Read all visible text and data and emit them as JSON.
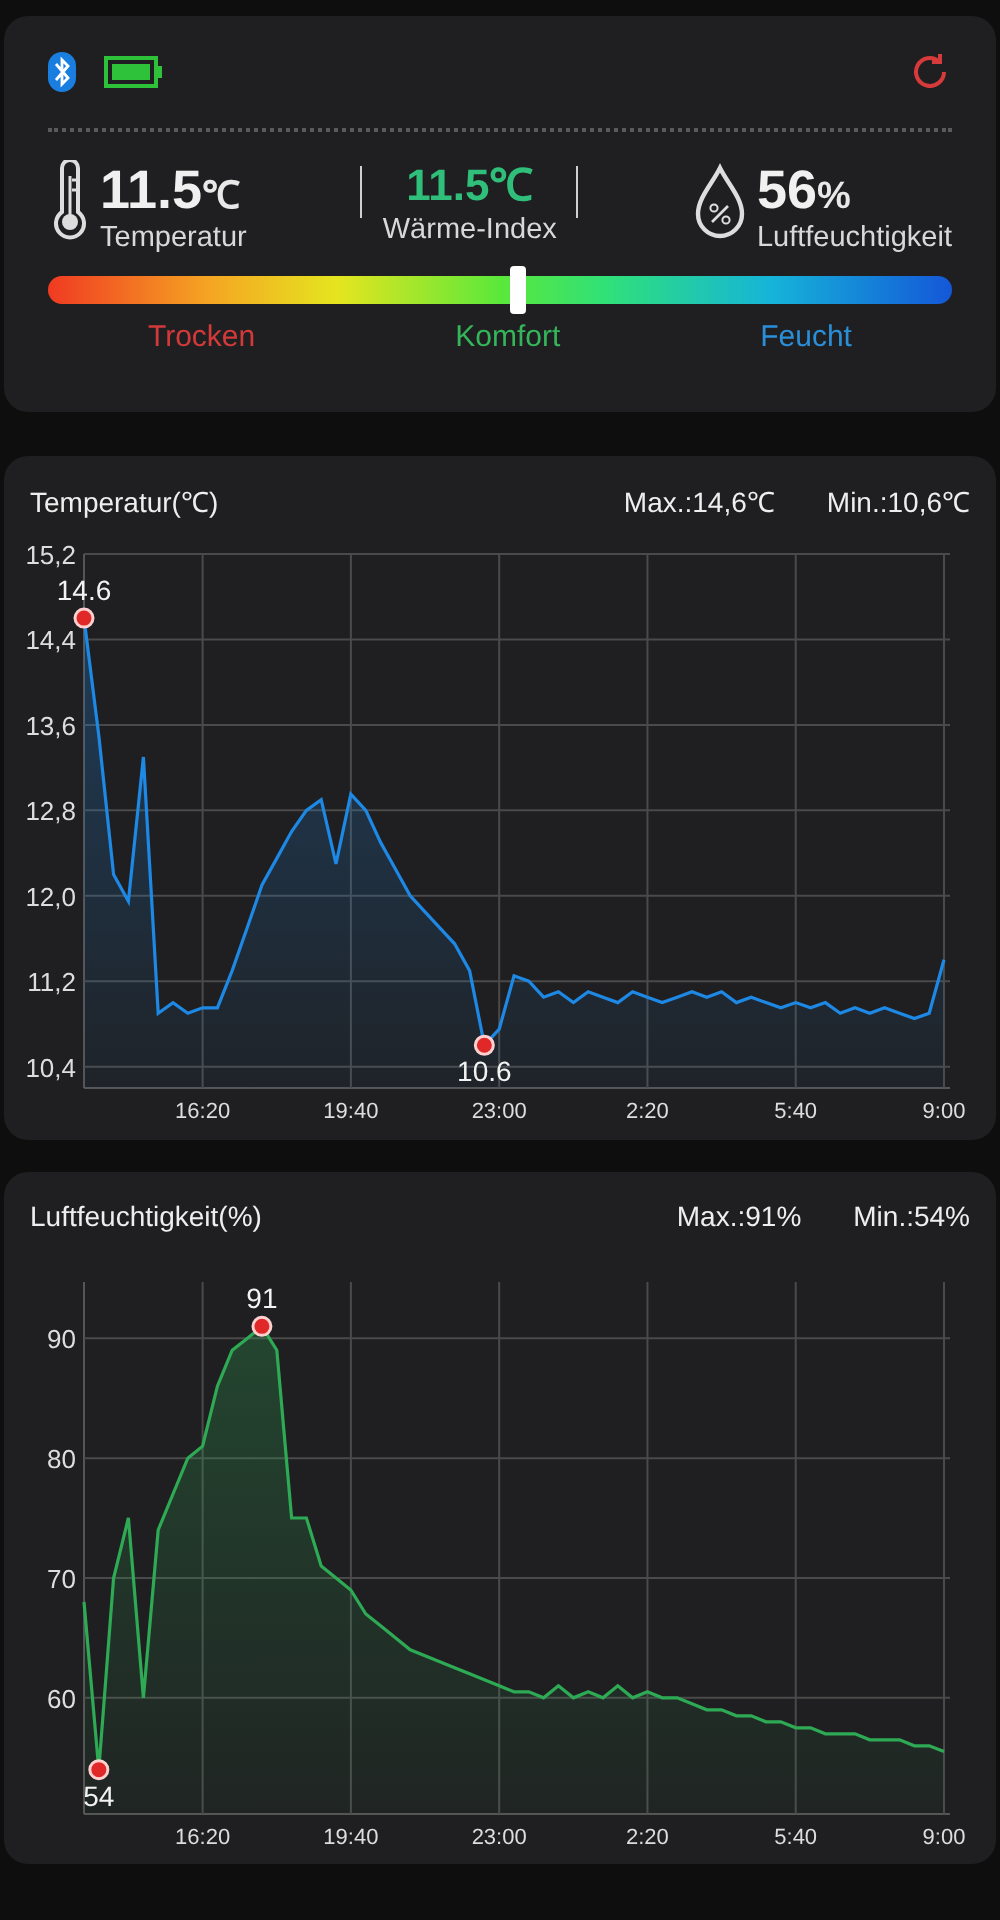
{
  "header": {
    "bluetooth": true,
    "battery": true,
    "readings": [
      {
        "kind": "temperature",
        "value": "11.5",
        "unit": "℃",
        "label": "Temperatur"
      },
      {
        "kind": "heat_index",
        "value": "11.5℃",
        "label": "Wärme-Index"
      },
      {
        "kind": "humidity",
        "value": "56",
        "unit": "%",
        "label": "Luftfeuchtigkeit"
      }
    ],
    "comfort": {
      "level": 0.52,
      "labels": [
        {
          "text": "Trocken",
          "color": "#d23a3a"
        },
        {
          "text": "Komfort",
          "color": "#34b55a"
        },
        {
          "text": "Feucht",
          "color": "#2a8fd8"
        }
      ]
    }
  },
  "charts": [
    {
      "title": "Temperatur(℃)",
      "max": "Max.:14,6℃",
      "min": "Min.:10,6℃",
      "chart_data": {
        "type": "area",
        "categories": [
          null,
          null,
          null,
          null,
          null,
          null,
          null,
          null,
          "16:20",
          null,
          null,
          null,
          null,
          null,
          null,
          null,
          null,
          null,
          "19:40",
          null,
          null,
          null,
          null,
          null,
          null,
          null,
          null,
          null,
          "23:00",
          null,
          null,
          null,
          null,
          null,
          null,
          null,
          null,
          null,
          "2:20",
          null,
          null,
          null,
          null,
          null,
          null,
          null,
          null,
          null,
          "5:40",
          null,
          null,
          null,
          null,
          null,
          null,
          null,
          null,
          null,
          "9:00"
        ],
        "series": [
          {
            "color": "#1e88e5",
            "values": [
              14.6,
              13.5,
              12.2,
              11.95,
              13.3,
              10.9,
              11.0,
              10.9,
              10.95,
              10.95,
              11.3,
              11.7,
              12.1,
              12.35,
              12.6,
              12.8,
              12.9,
              12.3,
              12.95,
              12.8,
              12.5,
              12.25,
              12.0,
              11.85,
              11.7,
              11.55,
              11.3,
              10.6,
              10.75,
              11.25,
              11.2,
              11.05,
              11.1,
              11.0,
              11.1,
              11.05,
              11.0,
              11.1,
              11.05,
              11.0,
              11.05,
              11.1,
              11.05,
              11.1,
              11.0,
              11.05,
              11.0,
              10.95,
              11.0,
              10.95,
              11.0,
              10.9,
              10.95,
              10.9,
              10.95,
              10.9,
              10.85,
              10.9,
              11.4
            ]
          }
        ],
        "ylim": [
          10.2,
          15.2
        ],
        "yticks": [
          {
            "value": 10.4,
            "label": "10,4"
          },
          {
            "value": 11.2,
            "label": "11,2"
          },
          {
            "value": 12,
            "label": "12,0"
          },
          {
            "value": 12.8,
            "label": "12,8"
          },
          {
            "value": 13.6,
            "label": "13,6"
          },
          {
            "value": 14.4,
            "label": "14,4"
          },
          {
            "value": 15.2,
            "label": "15,2"
          }
        ],
        "grid": true,
        "annotations": [
          {
            "y": 14.6,
            "text": "14.6"
          },
          {
            "y": 10.6,
            "text": "10.6"
          }
        ]
      }
    },
    {
      "title": "Luftfeuchtigkeit(%)",
      "max": "Max.:91%",
      "min": "Min.:54%",
      "chart_data": {
        "type": "area",
        "categories": [
          null,
          null,
          null,
          null,
          null,
          null,
          null,
          null,
          "16:20",
          null,
          null,
          null,
          null,
          null,
          null,
          null,
          null,
          null,
          "19:40",
          null,
          null,
          null,
          null,
          null,
          null,
          null,
          null,
          null,
          "23:00",
          null,
          null,
          null,
          null,
          null,
          null,
          null,
          null,
          null,
          "2:20",
          null,
          null,
          null,
          null,
          null,
          null,
          null,
          null,
          null,
          "5:40",
          null,
          null,
          null,
          null,
          null,
          null,
          null,
          null,
          null,
          "9:00"
        ],
        "series": [
          {
            "color": "#2eaa55",
            "values": [
              68,
              54,
              70,
              75,
              60,
              74,
              77,
              80,
              81,
              86,
              89,
              90,
              91,
              89,
              75,
              75,
              71,
              70,
              69,
              67,
              66,
              65,
              64,
              63.5,
              63,
              62.5,
              62,
              61.5,
              61,
              60.5,
              60.5,
              60,
              61,
              60,
              60.5,
              60,
              61,
              60,
              60.5,
              60,
              60,
              59.5,
              59,
              59,
              58.5,
              58.5,
              58,
              58,
              57.5,
              57.5,
              57,
              57,
              57,
              56.5,
              56.5,
              56.5,
              56,
              56,
              55.5
            ]
          }
        ],
        "ylim": [
          50.3,
          94.7
        ],
        "yticks": [
          {
            "value": 60,
            "label": "60"
          },
          {
            "value": 70,
            "label": "70"
          },
          {
            "value": 80,
            "label": "80"
          },
          {
            "value": 90,
            "label": "90"
          }
        ],
        "grid": true,
        "annotations": [
          {
            "y": 91,
            "text": "91"
          },
          {
            "y": 54,
            "text": "54"
          }
        ]
      }
    }
  ]
}
